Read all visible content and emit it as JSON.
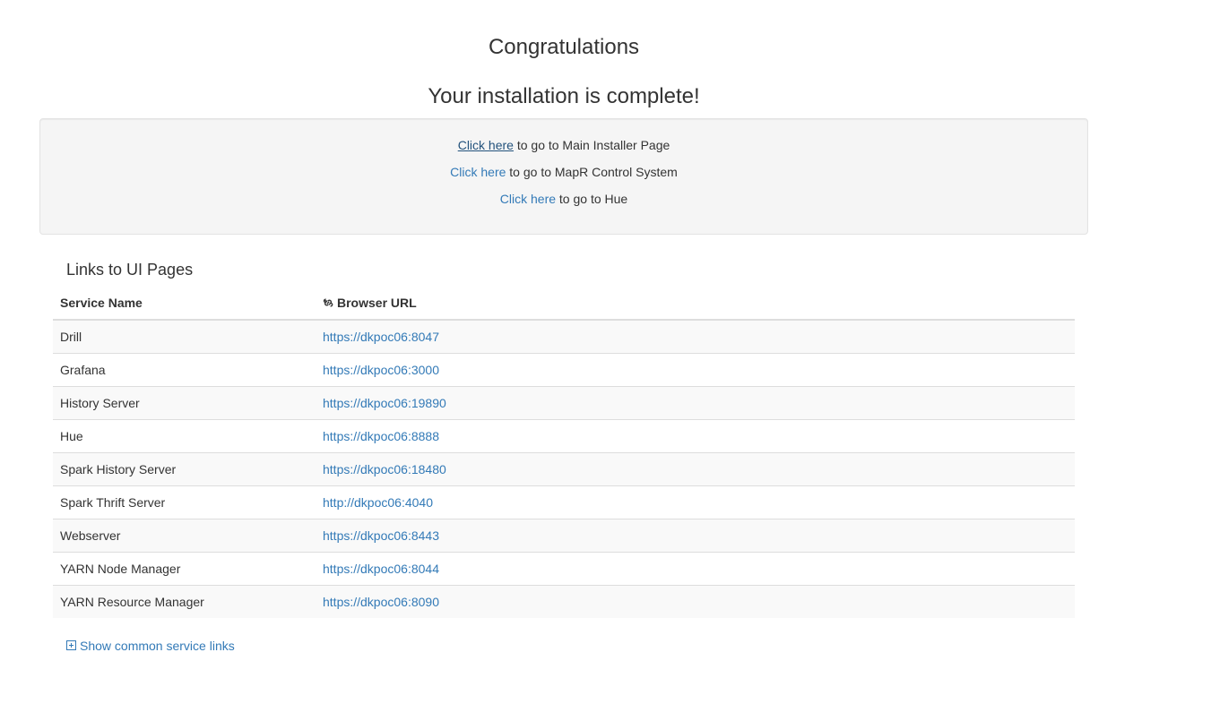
{
  "header": {
    "title": "Congratulations",
    "subtitle": "Your installation is complete!"
  },
  "well": {
    "lines": [
      {
        "link": "Click here",
        "text": " to go to Main Installer Page"
      },
      {
        "link": "Click here",
        "text": " to go to MapR Control System"
      },
      {
        "link": "Click here",
        "text": " to go to Hue"
      }
    ]
  },
  "links_section": {
    "title": "Links to UI Pages",
    "columns": {
      "service_name": "Service Name",
      "browser_url": "Browser URL"
    },
    "rows": [
      {
        "service": "Drill",
        "url": "https://dkpoc06:8047"
      },
      {
        "service": "Grafana",
        "url": "https://dkpoc06:3000"
      },
      {
        "service": "History Server",
        "url": "https://dkpoc06:19890"
      },
      {
        "service": "Hue",
        "url": "https://dkpoc06:8888"
      },
      {
        "service": "Spark History Server",
        "url": "https://dkpoc06:18480"
      },
      {
        "service": "Spark Thrift Server",
        "url": "http://dkpoc06:4040"
      },
      {
        "service": "Webserver",
        "url": "https://dkpoc06:8443"
      },
      {
        "service": "YARN Node Manager",
        "url": "https://dkpoc06:8044"
      },
      {
        "service": "YARN Resource Manager",
        "url": "https://dkpoc06:8090"
      }
    ],
    "toggle_label": "Show common service links"
  },
  "icons": {
    "browser_url": "link-icon",
    "toggle": "plus-square-icon"
  },
  "colors": {
    "link": "#337ab7",
    "link_active": "#23527c",
    "well_bg": "#f5f5f5",
    "stripe": "#f9f9f9"
  }
}
